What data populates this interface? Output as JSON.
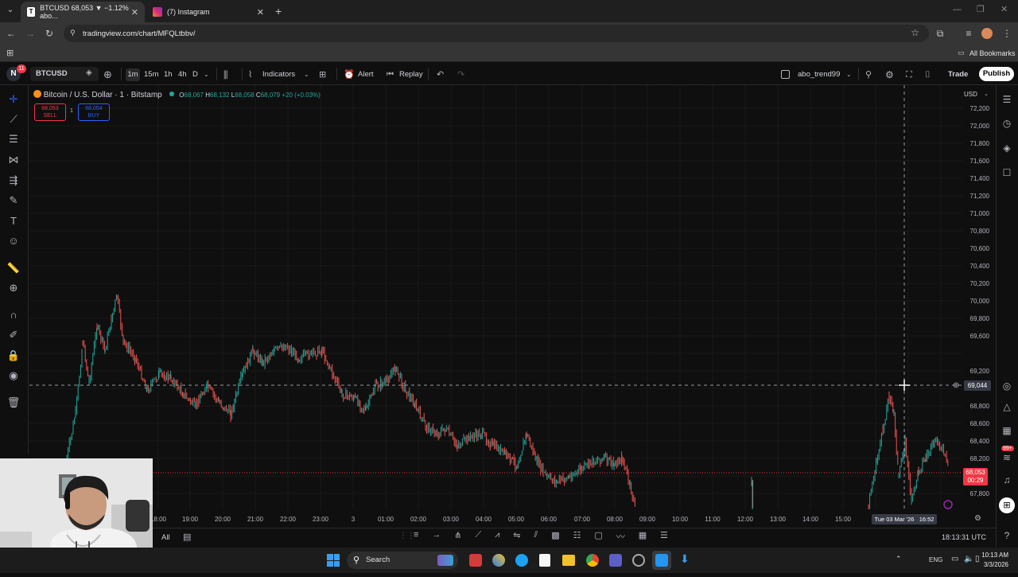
{
  "browser": {
    "tabs": [
      {
        "title": "BTCUSD 68,053 ▼ −1.12% abo...",
        "active": true
      },
      {
        "title": "(7) Instagram",
        "active": false
      }
    ],
    "url": "tradingview.com/chart/MFQLtbbv/",
    "bookmarks_label": "All Bookmarks"
  },
  "toolbar": {
    "notifications": "11",
    "avatar_letter": "N",
    "symbol": "BTCUSD",
    "intervals": [
      "1m",
      "15m",
      "1h",
      "4h",
      "D"
    ],
    "active_interval": "1m",
    "indicators_label": "Indicators",
    "alert_label": "Alert",
    "replay_label": "Replay",
    "layout_name": "abo_trend99",
    "trade_label": "Trade",
    "publish_label": "Publish"
  },
  "legend": {
    "title": "Bitcoin / U.S. Dollar · 1 · Bitstamp",
    "o_label": "O",
    "open": "68,067",
    "h_label": "H",
    "high": "68,132",
    "l_label": "L",
    "low": "68,058",
    "c_label": "C",
    "close": "68,079",
    "change": "+20 (+0.03%)",
    "sell_price": "68,053",
    "sell_label": "SELL",
    "spread": "1",
    "buy_price": "68,054",
    "buy_label": "BUY"
  },
  "price_scale": {
    "currency": "USD",
    "labels": [
      "72,200",
      "72,000",
      "71,800",
      "71,600",
      "71,400",
      "71,200",
      "71,000",
      "70,800",
      "70,600",
      "70,400",
      "70,200",
      "70,000",
      "69,800",
      "69,600",
      "69,200",
      "68,800",
      "68,600",
      "68,400",
      "68,200",
      "67,800"
    ],
    "crosshair_price": "69,044",
    "last_price": "68,053",
    "countdown": "00:29"
  },
  "time_scale": {
    "labels": [
      "18:00",
      "19:00",
      "20:00",
      "21:00",
      "22:00",
      "23:00",
      "3",
      "01:00",
      "02:00",
      "03:00",
      "04:00",
      "05:00",
      "06:00",
      "07:00",
      "08:00",
      "09:00",
      "10:00",
      "11:00",
      "12:00",
      "13:00",
      "14:00",
      "15:00",
      "16:00"
    ],
    "crosshair_time": "Tue 03 Mar '26   16:52"
  },
  "bottom": {
    "range_all": "All",
    "clock": "18:13:31 UTC"
  },
  "taskbar": {
    "search_label": "Search",
    "lang": "ENG",
    "time": "10:13 AM",
    "date": "3/3/2026"
  },
  "colors": {
    "up": "#26a69a",
    "down": "#ef5350",
    "accent": "#2962ff",
    "background": "#0f0f0f"
  }
}
